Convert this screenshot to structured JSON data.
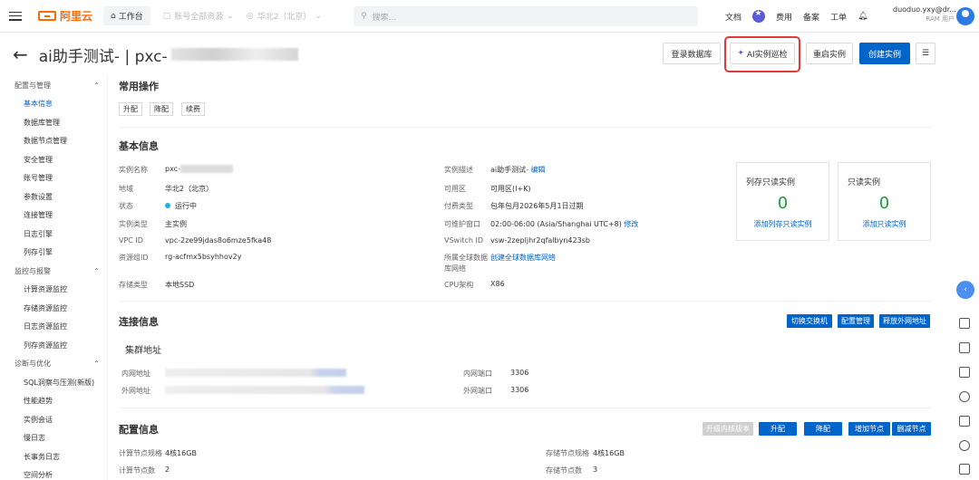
{
  "topbar": {
    "logo": "阿里云",
    "workbench": "工作台",
    "account_select": "账号全部资源",
    "region_select": "华北2（北京）",
    "search_placeholder": "搜索...",
    "nav": [
      "文档",
      "费用",
      "备案",
      "工单"
    ],
    "user_name": "duoduo.yxy@dr...",
    "user_role": "RAM 用户"
  },
  "header": {
    "title": "ai助手测试- | pxc-",
    "buttons": {
      "login_db": "登录数据库",
      "ai_patrol": "AI实例巡检",
      "restart": "重启实例",
      "create": "创建实例"
    }
  },
  "sidebar": [
    {
      "group": "配置与管理",
      "items": [
        "基本信息",
        "数据库管理",
        "数据节点管理",
        "安全管理",
        "账号管理",
        "参数设置",
        "连接管理",
        "日志引擎",
        "列存引擎"
      ]
    },
    {
      "group": "监控与报警",
      "items": [
        "计算资源监控",
        "存储资源监控",
        "日志资源监控",
        "列存资源监控"
      ]
    },
    {
      "group": "诊断与优化",
      "items": [
        "SQL洞察与压测(新版)",
        "性能趋势",
        "实例会话",
        "慢日志",
        "长事务日志",
        "空间分析"
      ]
    }
  ],
  "common_ops": {
    "title": "常用操作",
    "buttons": [
      "升配",
      "降配",
      "续费"
    ]
  },
  "basic_info": {
    "title": "基本信息",
    "left": [
      {
        "label": "实例名称",
        "value": "pxc-"
      },
      {
        "label": "地域",
        "value": "华北2（北京）"
      },
      {
        "label": "状态",
        "value": "运行中"
      },
      {
        "label": "实例类型",
        "value": "主实例"
      },
      {
        "label": "VPC ID",
        "value": "vpc-2ze99jdas8o6mze5fka48"
      },
      {
        "label": "资源组ID",
        "value": "rg-acfmx5bsyhhov2y"
      },
      {
        "label": "存储类型",
        "value": "本地SSD"
      }
    ],
    "right": [
      {
        "label": "实例描述",
        "value": "ai助手测试-",
        "action": "编辑"
      },
      {
        "label": "可用区",
        "value": "可用区(I+K)"
      },
      {
        "label": "付费类型",
        "value": "包年包月2026年5月1日过期"
      },
      {
        "label": "可维护窗口",
        "value": "02:00-06:00 (Asia/Shanghai UTC+8)",
        "action": "修改"
      },
      {
        "label": "VSwitch ID",
        "value": "vsw-2zepljhr2qfalbyn423sb"
      },
      {
        "label": "所属全球数据库网络",
        "value": "",
        "action": "创建全球数据库网络"
      },
      {
        "label": "CPU架构",
        "value": "X86"
      }
    ],
    "cards": [
      {
        "title": "列存只读实例",
        "count": "0",
        "link": "添加列存只读实例"
      },
      {
        "title": "只读实例",
        "count": "0",
        "link": "添加只读实例"
      }
    ]
  },
  "connection": {
    "title": "连接信息",
    "buttons": [
      "切换交换机",
      "配置管理",
      "释放外网地址"
    ],
    "cluster_title": "集群地址",
    "rows": [
      {
        "label": "内网地址",
        "port_label": "内网端口",
        "port": "3306"
      },
      {
        "label": "外网地址",
        "port_label": "外网端口",
        "port": "3306"
      }
    ]
  },
  "config": {
    "title": "配置信息",
    "buttons": [
      "升级内核版本",
      "升配",
      "降配",
      "增加节点",
      "删减节点"
    ],
    "rows": [
      {
        "label": "计算节点规格",
        "value": "4核16GB",
        "label2": "存储节点规格",
        "value2": "4核16GB"
      },
      {
        "label": "计算节点数",
        "value": "2",
        "label2": "存储节点数",
        "value2": "3"
      }
    ]
  },
  "colors": {
    "primary": "#0064c8",
    "accent": "#ff6a00",
    "highlight": "#e03a3a",
    "success": "#1a9e3a"
  }
}
